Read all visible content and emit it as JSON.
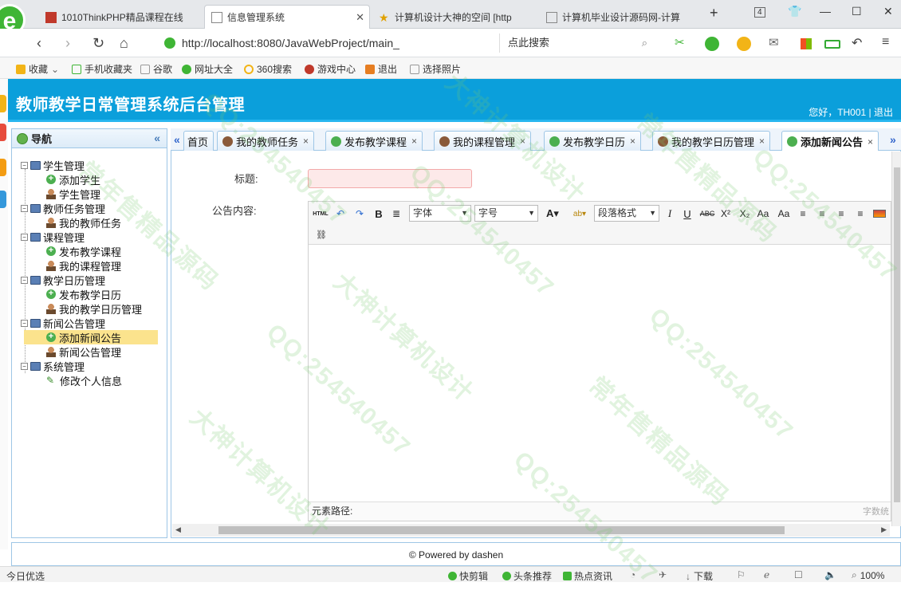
{
  "browser": {
    "tabs": [
      {
        "label": "1010ThinkPHP精品课程在线"
      },
      {
        "label": "信息管理系统"
      },
      {
        "label": "计算机设计大神的空间 [http"
      },
      {
        "label": "计算机毕业设计源码网-计算"
      }
    ],
    "new_tab": "+",
    "tab_count": "4",
    "url": "http://localhost:8080/JavaWebProject/main_",
    "search_placeholder": "点此搜索",
    "bookmarks": [
      "收藏",
      "手机收藏夹",
      "谷歌",
      "网址大全",
      "360搜索",
      "游戏中心",
      "退出",
      "选择照片"
    ]
  },
  "app": {
    "title": "教师教学日常管理系统后台管理",
    "user_info": "您好，TH001 | 退出"
  },
  "nav": {
    "title": "导航",
    "groups": [
      {
        "label": "学生管理",
        "items": [
          "添加学生",
          "学生管理"
        ]
      },
      {
        "label": "教师任务管理",
        "items": [
          "我的教师任务"
        ]
      },
      {
        "label": "课程管理",
        "items": [
          "发布教学课程",
          "我的课程管理"
        ]
      },
      {
        "label": "教学日历管理",
        "items": [
          "发布教学日历",
          "我的教学日历管理"
        ]
      },
      {
        "label": "新闻公告管理",
        "items": [
          "添加新闻公告",
          "新闻公告管理"
        ]
      },
      {
        "label": "系统管理",
        "items": [
          "修改个人信息"
        ]
      }
    ]
  },
  "tabs": [
    {
      "label": "首页"
    },
    {
      "label": "我的教师任务"
    },
    {
      "label": "发布教学课程"
    },
    {
      "label": "我的课程管理"
    },
    {
      "label": "发布教学日历"
    },
    {
      "label": "我的教学日历管理"
    },
    {
      "label": "添加新闻公告"
    }
  ],
  "form": {
    "title_label": "标题:",
    "title_value": "",
    "content_label": "公告内容:"
  },
  "editor": {
    "font_select": "字体",
    "size_select": "字号",
    "para_select": "段落格式",
    "html_btn": "HTML",
    "path_label": "元素路径:",
    "word_count": "字数统"
  },
  "footer": {
    "text": "© Powered by dashen"
  },
  "statusbar": {
    "left": "今日优选",
    "items": [
      "快剪辑",
      "头条推荐",
      "热点资讯",
      "下载"
    ],
    "zoom": "100%"
  },
  "watermarks": [
    "大神计算机设计",
    "QQ:254540457",
    "常年售精品源码"
  ]
}
